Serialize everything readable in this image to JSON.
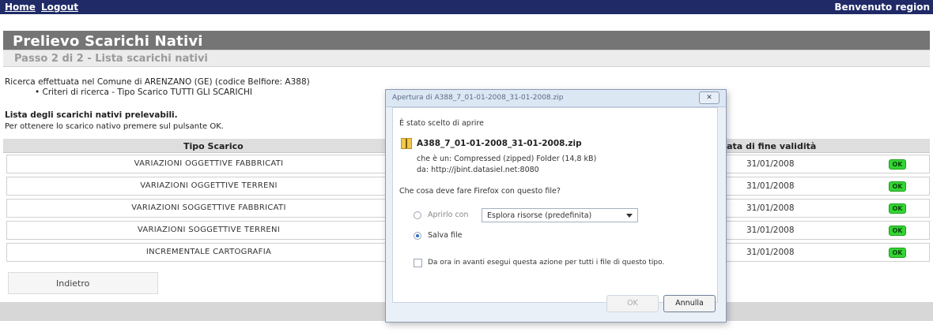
{
  "topbar": {
    "home": "Home",
    "logout": "Logout",
    "welcome": "Benvenuto region"
  },
  "page": {
    "title": "Prelievo Scarichi Nativi",
    "step": "Passo 2 di 2 - Lista scarichi nativi",
    "search_line": "Ricerca effettuata nel Comune di ARENZANO (GE) (codice Belfiore: A388)",
    "criteria": "•  Criteri di ricerca - Tipo Scarico TUTTI GLI SCARICHI",
    "list_title": "Lista degli scarichi nativi prelevabili.",
    "instruction": "Per ottenere lo scarico nativo premere sul pulsante OK."
  },
  "table": {
    "col_type": "Tipo Scarico",
    "col_date": "Data di fine validità",
    "rows": [
      {
        "type": "VARIAZIONI OGGETTIVE FABBRICATI",
        "date": "31/01/2008",
        "action": "OK"
      },
      {
        "type": "VARIAZIONI OGGETTIVE TERRENI",
        "date": "31/01/2008",
        "action": "OK"
      },
      {
        "type": "VARIAZIONI SOGGETTIVE FABBRICATI",
        "date": "31/01/2008",
        "action": "OK"
      },
      {
        "type": "VARIAZIONI SOGGETTIVE TERRENI",
        "date": "31/01/2008",
        "action": "OK"
      },
      {
        "type": "INCREMENTALE CARTOGRAFIA",
        "date": "31/01/2008",
        "action": "OK"
      }
    ]
  },
  "back_button": "Indietro",
  "dialog": {
    "title": "Apertura di A388_7_01-01-2008_31-01-2008.zip",
    "close": "✕",
    "intro": "È stato scelto di aprire",
    "filename": "A388_7_01-01-2008_31-01-2008.zip",
    "type_line": "che è un:  Compressed (zipped) Folder (14,8  kB)",
    "from_line": "da:  http://jbint.datasiel.net:8080",
    "question": "Che cosa deve fare Firefox con questo file?",
    "open_with_label": "Aprirlo con",
    "open_with_value": "Esplora risorse (predefinita)",
    "save_label": "Salva file",
    "remember_label": "Da ora in avanti esegui questa azione per tutti i file di questo tipo.",
    "ok": "OK",
    "cancel": "Annulla"
  },
  "colors": {
    "topbar": "#1f2a66",
    "title_bg": "#757575",
    "ok_green": "#34d434",
    "dialog_bg": "#eaf0f7"
  }
}
